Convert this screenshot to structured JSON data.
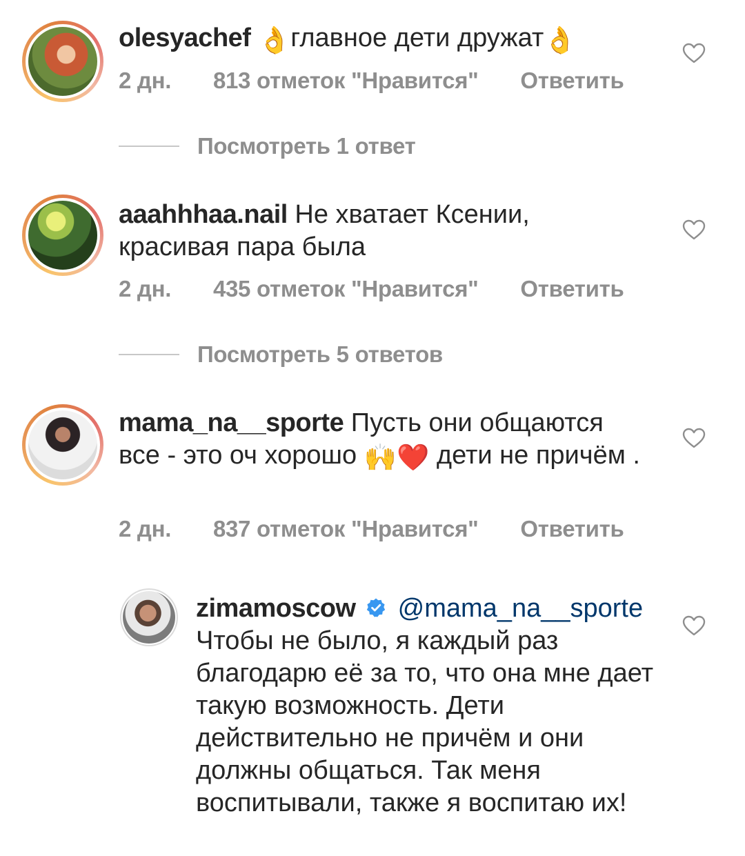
{
  "comments": [
    {
      "username": "olesyachef",
      "text_parts": [
        "",
        "главное дети дружат",
        ""
      ],
      "emoji_parts": [
        "👌",
        "👌"
      ],
      "time": "2 дн.",
      "likes": "813 отметок \"Нравится\"",
      "reply": "Ответить",
      "avatar_icon": "avatar-photo"
    },
    {
      "username": "aaahhhaa.nail",
      "text": "Не хватает Ксении, красивая пара была",
      "time": "2 дн.",
      "likes": "435 отметок \"Нравится\"",
      "reply": "Ответить",
      "avatar_icon": "avatar-photo"
    },
    {
      "username": "mama_na__sporte",
      "text_before_emoji": "Пусть они общаются все - это оч хорошо ",
      "emoji": [
        "🙌",
        "❤️"
      ],
      "text_after_emoji": " дети не причём .",
      "time": "2 дн.",
      "likes": "837 отметок \"Нравится\"",
      "reply": "Ответить",
      "avatar_icon": "avatar-photo"
    }
  ],
  "view_replies": [
    {
      "label": "Посмотреть 1 ответ"
    },
    {
      "label": "Посмотреть 5 ответов"
    }
  ],
  "reply_comment": {
    "username": "zimamoscow",
    "verified": true,
    "mention": "@mama_na__sporte",
    "text": "Чтобы не было, я каждый раз благодарю её за то, что она мне дает такую возможность. Дети действительно не причём и они должны общаться. Так меня воспитывали, также я воспитаю их!",
    "avatar_icon": "avatar-photo"
  },
  "icons": {
    "like": "heart-outline-icon",
    "verified": "verified-badge-icon"
  },
  "colors": {
    "text": "#262626",
    "secondary": "#8e8e8e",
    "mention": "#00376b",
    "verified": "#3897f0"
  }
}
